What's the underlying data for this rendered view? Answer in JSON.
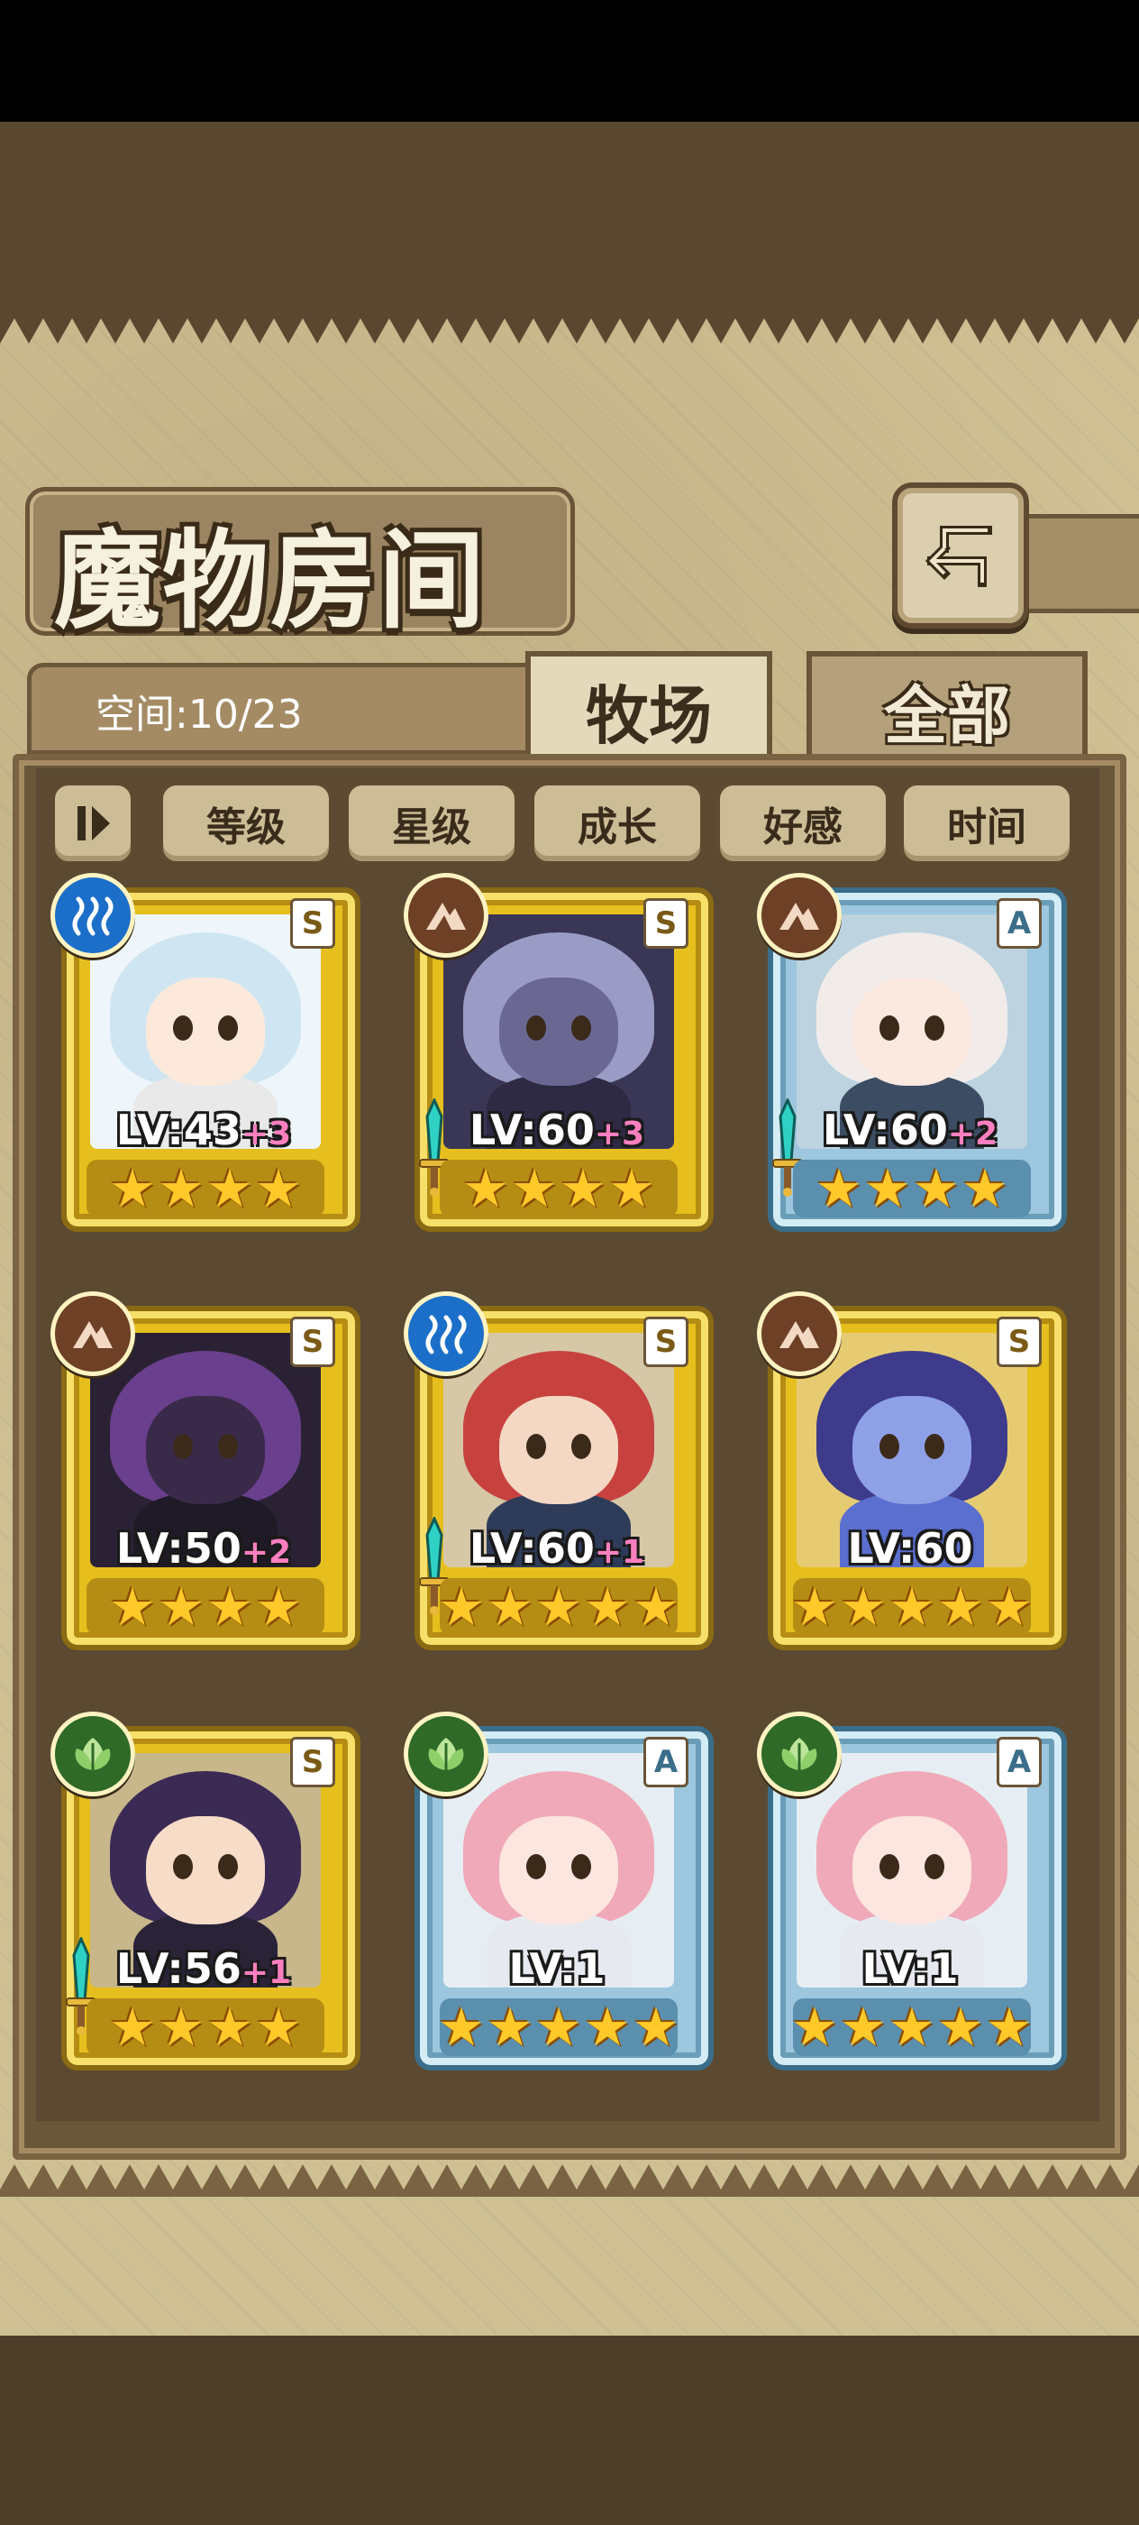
{
  "header": {
    "title": "魔物房间",
    "back_icon": "return-arrow-icon"
  },
  "capacity": {
    "label": "空间:10/23"
  },
  "tabs": [
    {
      "label": "牧场",
      "active": true
    },
    {
      "label": "全部",
      "active": false
    }
  ],
  "sort_buttons": {
    "toggle_icon": "pause-toggle-icon",
    "items": [
      "等级",
      "星级",
      "成长",
      "好感",
      "时间"
    ]
  },
  "colors": {
    "gold_frame": "#e6bf1e",
    "blue_frame": "#9cc7de",
    "level_bonus": "#ff7fbf"
  },
  "monsters": [
    {
      "level": "LV:43",
      "bonus": "+3",
      "stars": 4,
      "element": "water",
      "element_icon": "water-wave-icon",
      "rank": "S",
      "frame": "gold",
      "weapon": false
    },
    {
      "level": "LV:60",
      "bonus": "+3",
      "stars": 4,
      "element": "earth",
      "element_icon": "mountain-icon",
      "rank": "S",
      "frame": "gold",
      "weapon": true
    },
    {
      "level": "LV:60",
      "bonus": "+2",
      "stars": 4,
      "element": "earth",
      "element_icon": "mountain-icon",
      "rank": "A",
      "frame": "blue",
      "weapon": true
    },
    {
      "level": "LV:50",
      "bonus": "+2",
      "stars": 4,
      "element": "earth",
      "element_icon": "mountain-icon",
      "rank": "S",
      "frame": "gold",
      "weapon": false
    },
    {
      "level": "LV:60",
      "bonus": "+1",
      "stars": 5,
      "element": "water",
      "element_icon": "water-wave-icon",
      "rank": "S",
      "frame": "gold",
      "weapon": true
    },
    {
      "level": "LV:60",
      "bonus": "",
      "stars": 5,
      "element": "earth",
      "element_icon": "mountain-icon",
      "rank": "S",
      "frame": "gold",
      "weapon": false
    },
    {
      "level": "LV:56",
      "bonus": "+1",
      "stars": 4,
      "element": "wood",
      "element_icon": "leaf-icon",
      "rank": "S",
      "frame": "gold",
      "weapon": true
    },
    {
      "level": "LV:1",
      "bonus": "",
      "stars": 5,
      "element": "wood",
      "element_icon": "leaf-icon",
      "rank": "A",
      "frame": "blue",
      "weapon": false
    },
    {
      "level": "LV:1",
      "bonus": "",
      "stars": 5,
      "element": "wood",
      "element_icon": "leaf-icon",
      "rank": "A",
      "frame": "blue",
      "weapon": false
    }
  ]
}
